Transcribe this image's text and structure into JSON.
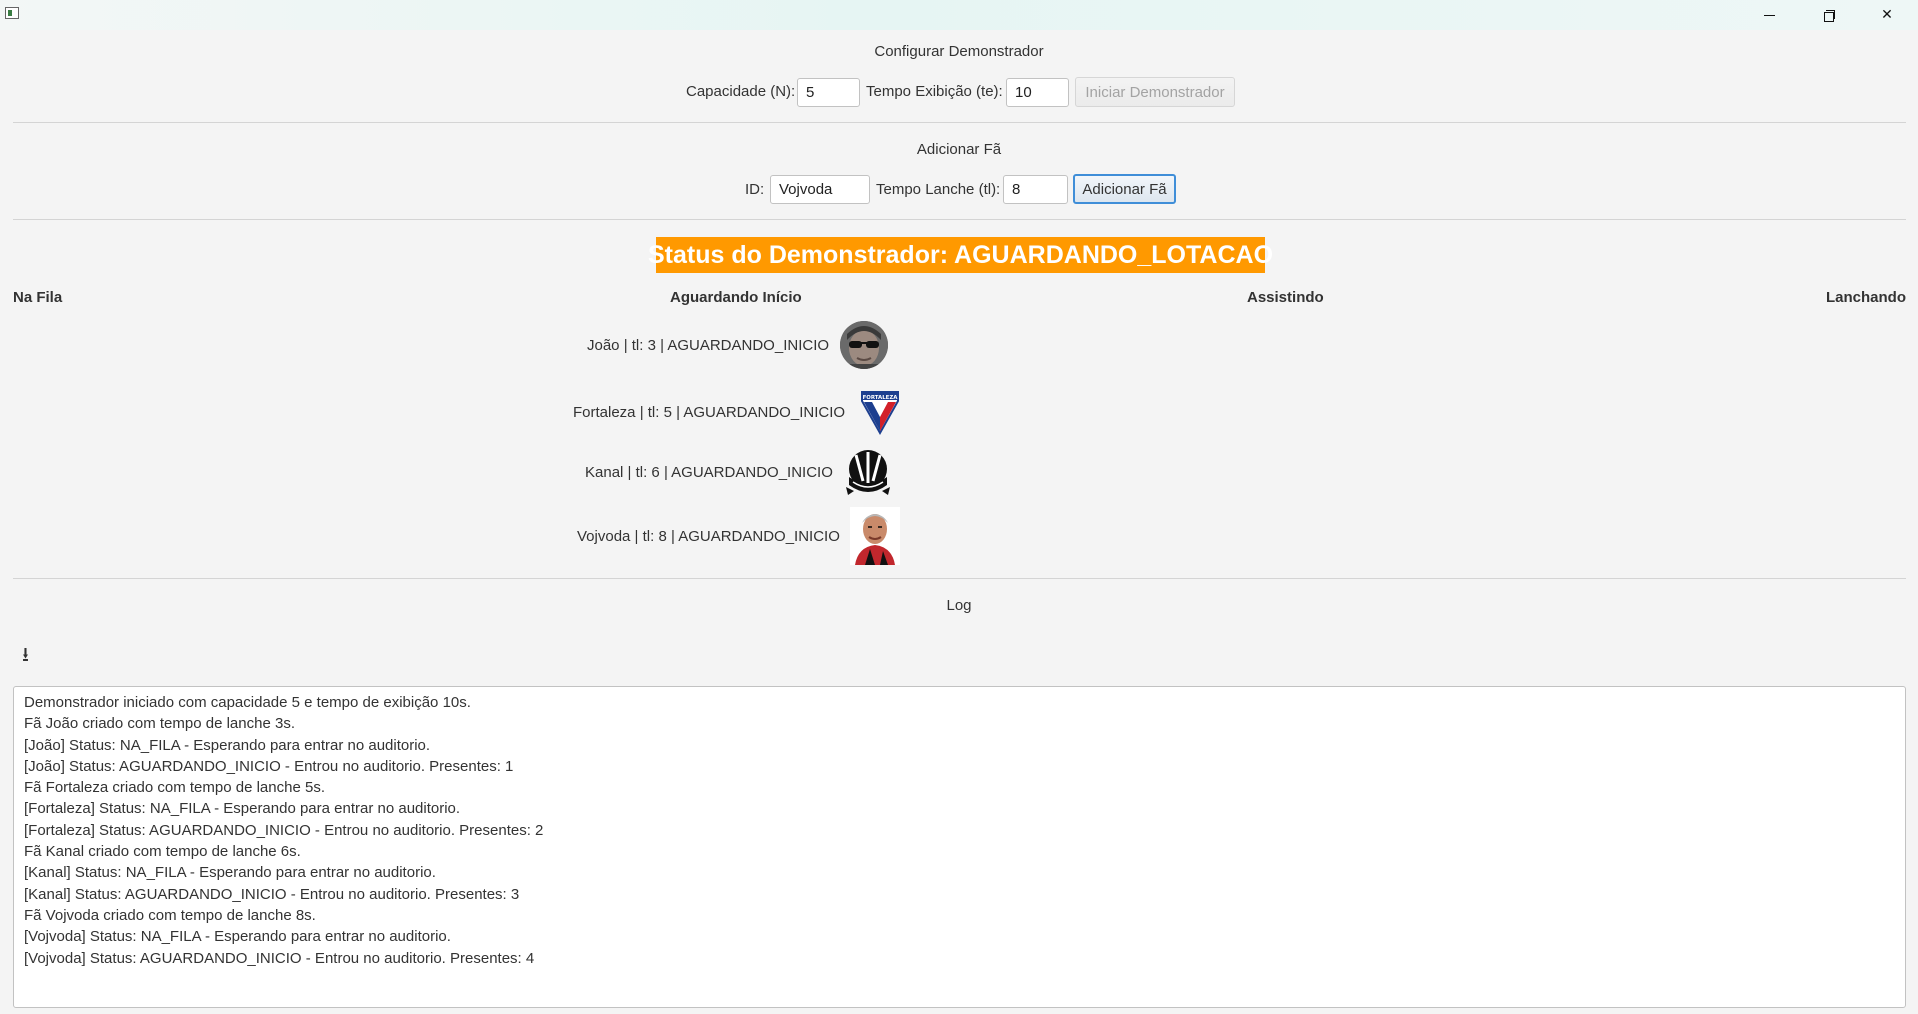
{
  "window": {
    "title": "",
    "controls": {
      "minimize_icon": "minimize-icon",
      "maximize_icon": "restore-icon",
      "close_icon": "close-icon",
      "close_glyph": "✕"
    }
  },
  "config": {
    "section_title": "Configurar Demonstrador",
    "capacity_label": "Capacidade (N):",
    "capacity_value": "5",
    "time_label": "Tempo Exibição (te):",
    "time_value": "10",
    "start_button": "Iniciar Demonstrador",
    "start_button_enabled": false
  },
  "add_fan": {
    "section_title": "Adicionar Fã",
    "id_label": "ID:",
    "id_value": "Vojvoda",
    "snack_label": "Tempo Lanche (tl):",
    "snack_value": "8",
    "add_button": "Adicionar Fã"
  },
  "status": {
    "text": "Status do Demonstrador: AGUARDANDO_LOTACAO",
    "color": "#ff9900"
  },
  "columns": {
    "queue": "Na Fila",
    "waiting": "Aguardando Início",
    "watching": "Assistindo",
    "snacking": "Lanchando"
  },
  "waiting_fans": [
    {
      "text": "João | tl: 3 | AGUARDANDO_INICIO",
      "avatar": "man-sunglasses-avatar"
    },
    {
      "text": "Fortaleza | tl: 5 | AGUARDANDO_INICIO",
      "avatar": "fortaleza-crest",
      "crest_text": "FORTALEZA"
    },
    {
      "text": "Kanal | tl: 6 | AGUARDANDO_INICIO",
      "avatar": "kanal-logo"
    },
    {
      "text": "Vojvoda | tl: 8 | AGUARDANDO_INICIO",
      "avatar": "vojvoda-avatar"
    }
  ],
  "log": {
    "section_title": "Log",
    "scroll_icon": "scroll-down-icon",
    "scroll_glyph": "⭳",
    "lines": [
      "Demonstrador iniciado com capacidade 5 e tempo de exibição 10s.",
      "Fã João criado com tempo de lanche 3s.",
      "[João] Status: NA_FILA - Esperando para entrar no auditorio.",
      "[João] Status: AGUARDANDO_INICIO - Entrou no auditorio. Presentes: 1",
      "Fã Fortaleza criado com tempo de lanche 5s.",
      "[Fortaleza] Status: NA_FILA - Esperando para entrar no auditorio.",
      "[Fortaleza] Status: AGUARDANDO_INICIO - Entrou no auditorio. Presentes: 2",
      "Fã Kanal criado com tempo de lanche 6s.",
      "[Kanal] Status: NA_FILA - Esperando para entrar no auditorio.",
      "[Kanal] Status: AGUARDANDO_INICIO - Entrou no auditorio. Presentes: 3",
      "Fã Vojvoda criado com tempo de lanche 8s.",
      "[Vojvoda] Status: NA_FILA - Esperando para entrar no auditorio.",
      "[Vojvoda] Status: AGUARDANDO_INICIO - Entrou no auditorio. Presentes: 4"
    ]
  }
}
